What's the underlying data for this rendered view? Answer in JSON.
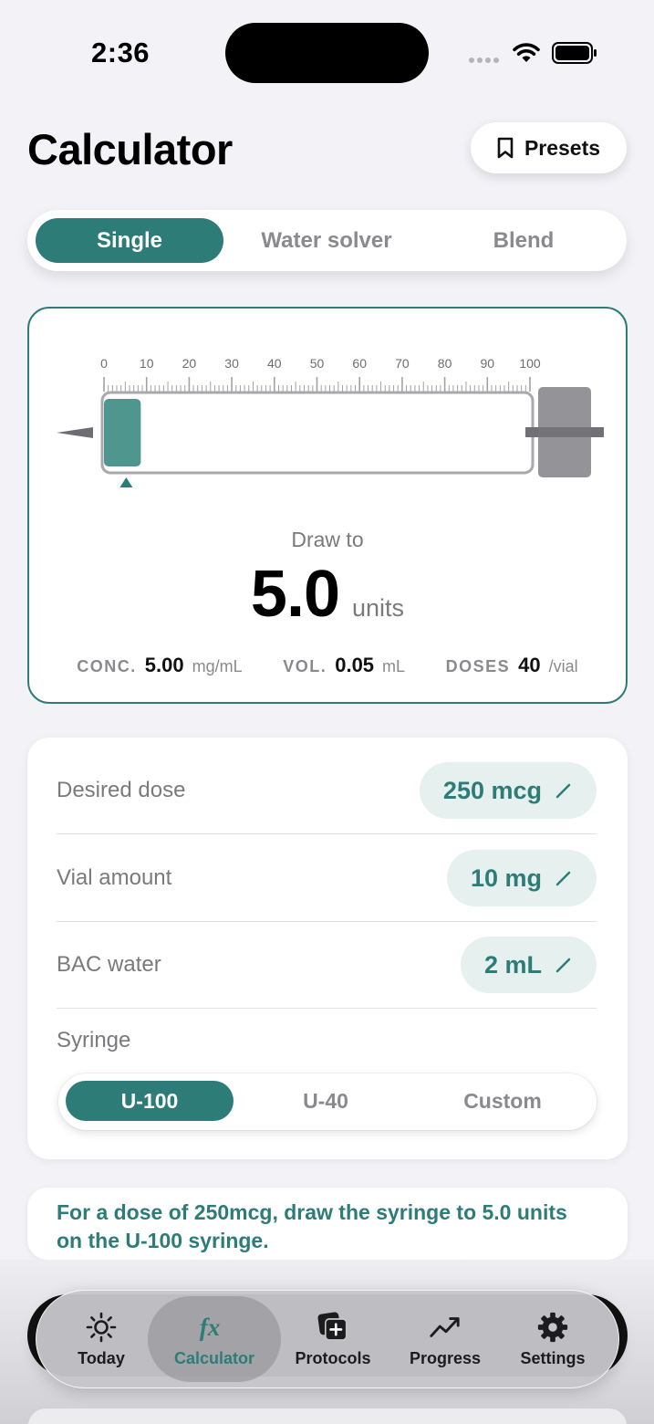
{
  "status_bar": {
    "time": "2:36"
  },
  "header": {
    "title": "Calculator",
    "presets_label": "Presets"
  },
  "mode_tabs": [
    {
      "label": "Single",
      "active": true
    },
    {
      "label": "Water solver",
      "active": false
    },
    {
      "label": "Blend",
      "active": false
    }
  ],
  "syringe": {
    "scale_labels": [
      "0",
      "10",
      "20",
      "30",
      "40",
      "50",
      "60",
      "70",
      "80",
      "90",
      "100"
    ],
    "scale_max": 100,
    "fill_units": 5.0,
    "draw_label": "Draw to",
    "draw_value": "5.0",
    "draw_unit": "units",
    "stats": {
      "conc_key": "CONC.",
      "conc_value": "5.00",
      "conc_unit": "mg/mL",
      "vol_key": "VOL.",
      "vol_value": "0.05",
      "vol_unit": "mL",
      "doses_key": "DOSES",
      "doses_value": "40",
      "doses_unit": "/vial"
    }
  },
  "inputs": {
    "desired_dose": {
      "label": "Desired dose",
      "value": "250 mcg"
    },
    "vial_amount": {
      "label": "Vial amount",
      "value": "10 mg"
    },
    "bac_water": {
      "label": "BAC water",
      "value": "2 mL"
    },
    "syringe_label": "Syringe",
    "syringe_types": [
      {
        "label": "U-100",
        "active": true
      },
      {
        "label": "U-40",
        "active": false
      },
      {
        "label": "Custom",
        "active": false
      }
    ]
  },
  "summary": {
    "text": "For a dose of 250mcg, draw the syringe to 5.0 units on the U-100 syringe."
  },
  "tab_bar": [
    {
      "label": "Today",
      "icon": "sun-icon"
    },
    {
      "label": "Calculator",
      "icon": "fx-icon",
      "active": true
    },
    {
      "label": "Protocols",
      "icon": "add-stack-icon"
    },
    {
      "label": "Progress",
      "icon": "trend-icon"
    },
    {
      "label": "Settings",
      "icon": "gear-icon"
    }
  ],
  "colors": {
    "accent": "#2e7c78",
    "background": "#f2f2f7",
    "pill": "#e6f0ef"
  }
}
